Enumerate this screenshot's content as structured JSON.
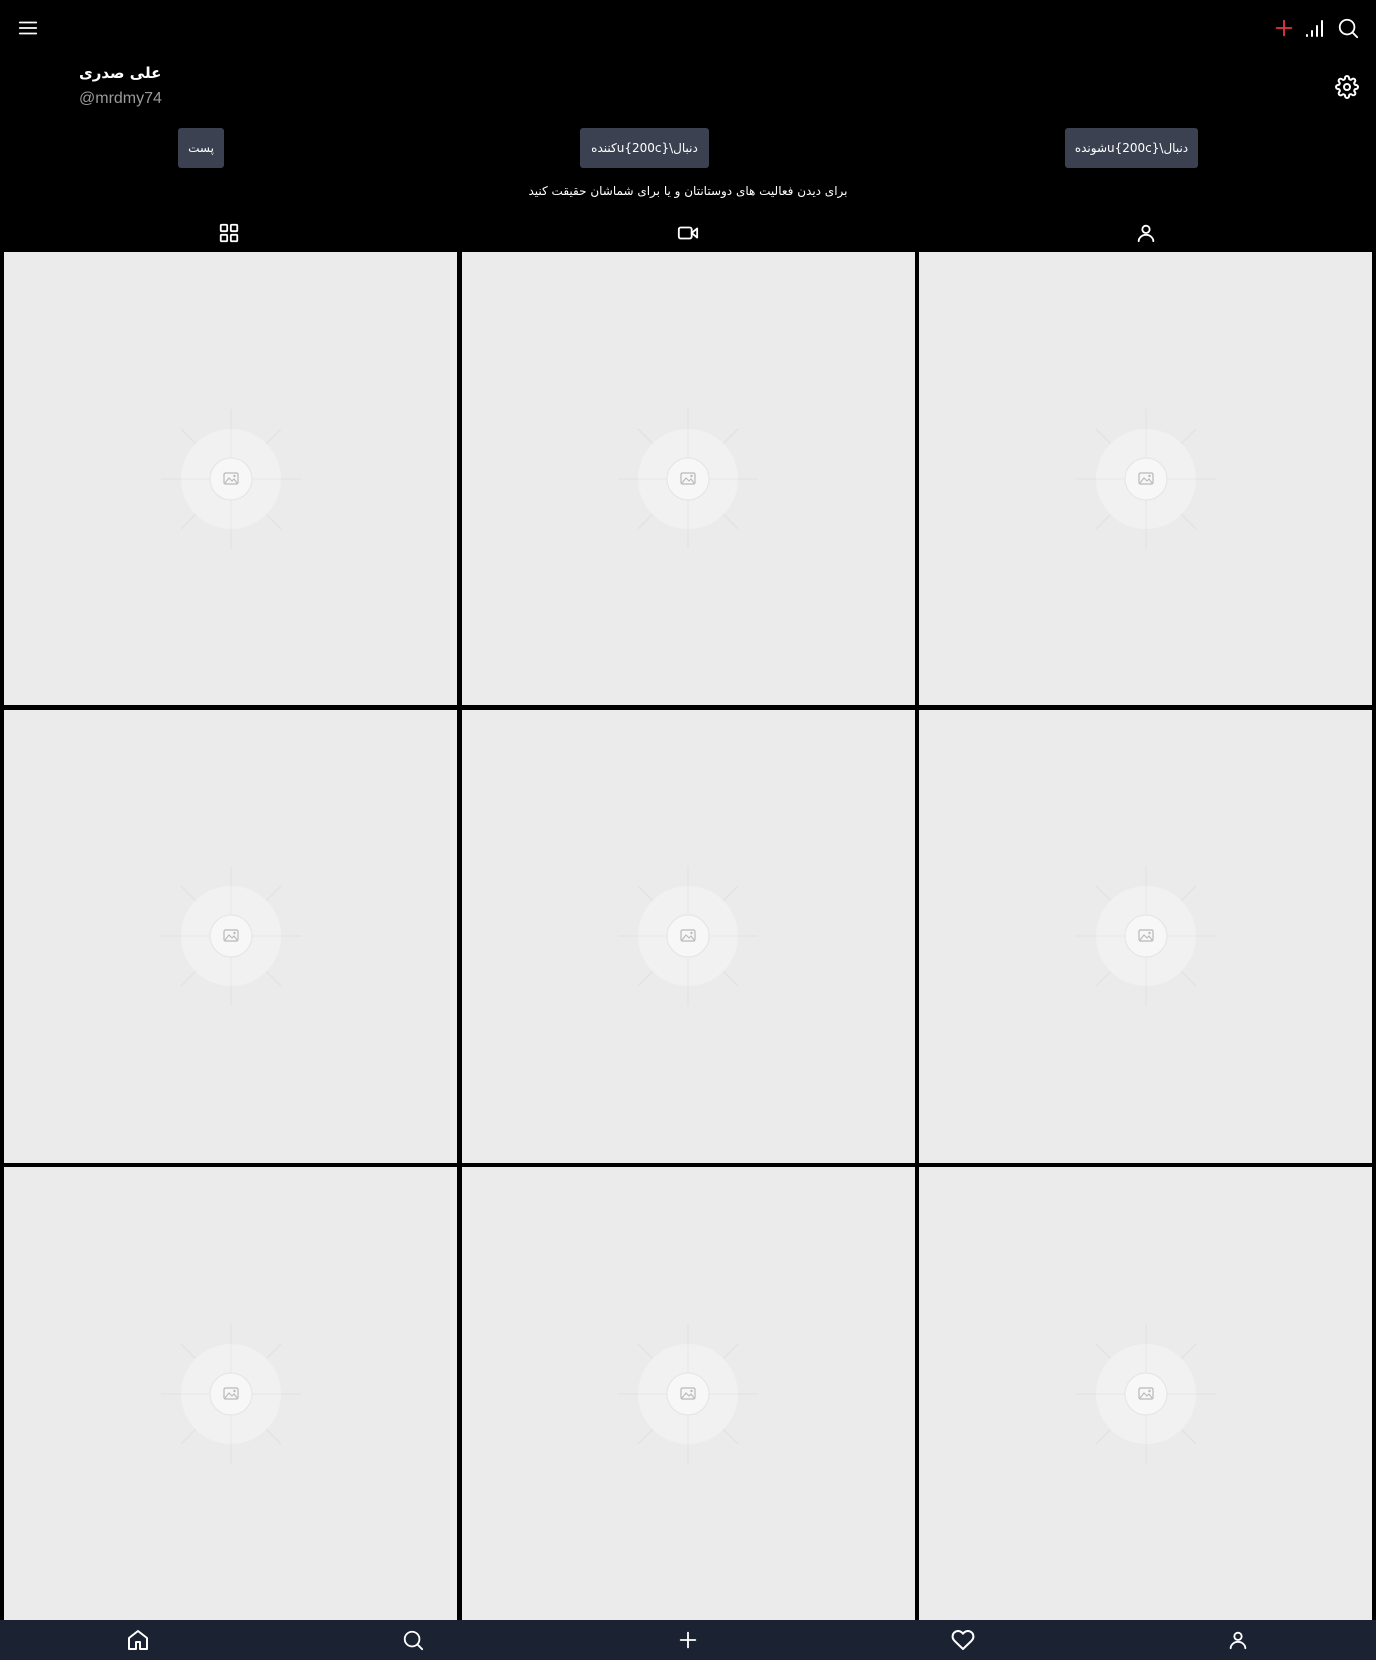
{
  "topbar": {
    "icons": [
      "menu-icon",
      "plus-icon",
      "signal-icon",
      "search-icon"
    ],
    "accent_color": "#e23744"
  },
  "profile": {
    "name": "علی صدری",
    "handle": "@mrdmy74"
  },
  "stats": {
    "posts_label": "پست",
    "following_label": "دنبال\\u{200c}کننده",
    "followers_label": "دنبال\\u{200c}شونده"
  },
  "info_text": "برای دیدن فعالیت های دوستانتان و یا برای شماشان حقیقت کنید",
  "tabs": [
    "grid-icon",
    "video-icon",
    "user-icon"
  ],
  "grid": {
    "tiles": 9,
    "tile_color": "#ebebeb"
  },
  "bottom_nav": {
    "items": [
      "home-icon",
      "search-icon",
      "plus-icon",
      "heart-icon",
      "user-icon"
    ],
    "background": "#1b2232"
  }
}
